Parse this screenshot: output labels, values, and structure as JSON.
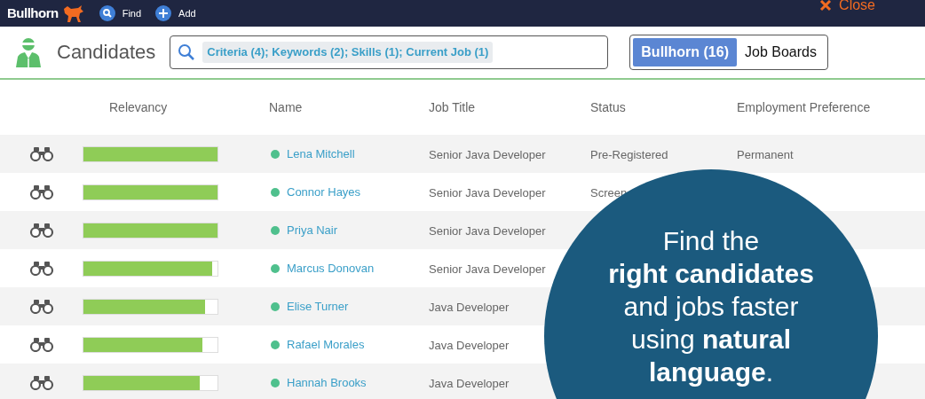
{
  "nav": {
    "logo": "Bullhorn",
    "items": [
      {
        "label": "Find",
        "kind": "find"
      },
      {
        "label": "Add",
        "kind": "add"
      }
    ],
    "close": "Close"
  },
  "page": {
    "title": "Candidates",
    "search_chip": "Criteria (4); Keywords (2); Skills (1); Current Job (1)",
    "sources": [
      {
        "label": "Bullhorn (16)",
        "selected": true
      },
      {
        "label": "Job Boards",
        "selected": false
      }
    ]
  },
  "table": {
    "columns": [
      "Relevancy",
      "Name",
      "Job Title",
      "Status",
      "Employment Preference"
    ],
    "rows": [
      {
        "level": 1,
        "name": "Lena Mitchell",
        "job_title": "Senior Java Developer",
        "status": "Pre-Registered",
        "preference": "Permanent"
      },
      {
        "level": 1,
        "name": "Connor Hayes",
        "job_title": "Senior Java Developer",
        "status": "Screen"
      },
      {
        "level": 1,
        "name": "Priya Nair",
        "job_title": "Senior Java Developer"
      },
      {
        "level": 0.96,
        "name": "Marcus Donovan",
        "job_title": "Senior Java Developer"
      },
      {
        "level": 0.91,
        "name": "Elise Turner",
        "job_title": "Java Developer"
      },
      {
        "level": 0.89,
        "name": "Rafael Morales",
        "job_title": "Java Developer"
      },
      {
        "level": 0.87,
        "name": "Hannah Brooks",
        "job_title": "Java Developer"
      }
    ]
  },
  "callout": "Find the\n**right candidates**\nand jobs faster\nusing **natural**\n**language**."
}
